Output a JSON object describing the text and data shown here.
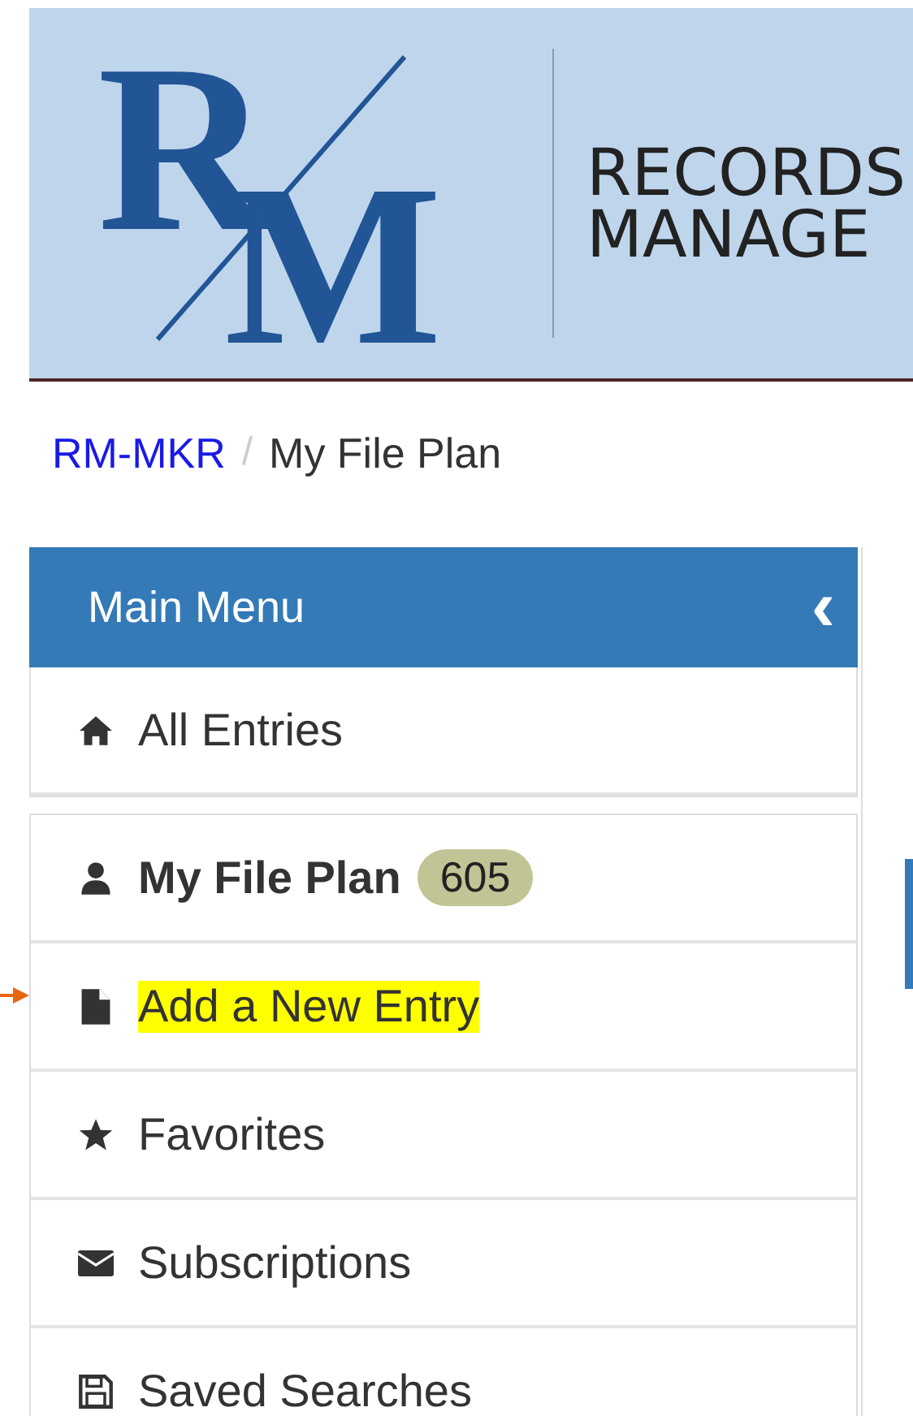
{
  "header": {
    "logo_letters": [
      "R",
      "M"
    ],
    "title_lines": [
      "RECORDS",
      "MANAGE"
    ]
  },
  "breadcrumb": [
    {
      "label": "RM-MKR",
      "link": true
    },
    {
      "label": "My File Plan",
      "link": false
    }
  ],
  "breadcrumb_separator": "/",
  "sidebar": {
    "title": "Main Menu",
    "collapse_icon": "‹",
    "top_items": [
      {
        "label": "All Entries",
        "bold": false,
        "highlighted": false
      }
    ],
    "items": [
      {
        "label": "My File Plan",
        "bold": true,
        "highlighted": false,
        "badge": "605"
      },
      {
        "label": "Add a New Entry",
        "bold": false,
        "highlighted": true,
        "annotated": true
      },
      {
        "label": "Favorites",
        "bold": false,
        "highlighted": false
      },
      {
        "label": "Subscriptions",
        "bold": false,
        "highlighted": false
      },
      {
        "label": "Saved Searches",
        "bold": false,
        "highlighted": false
      }
    ]
  }
}
